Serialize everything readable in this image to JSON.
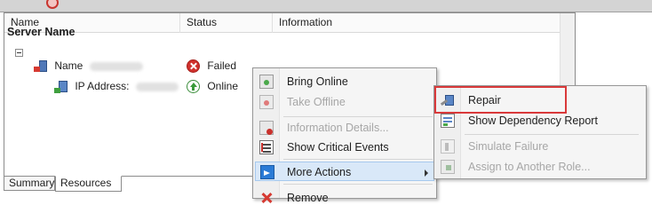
{
  "columns": {
    "name": "Name",
    "status": "Status",
    "information": "Information"
  },
  "group": {
    "label": "Server Name"
  },
  "rows": [
    {
      "name": "Name",
      "status": "Failed"
    },
    {
      "name": "IP Address:",
      "status": "Online"
    }
  ],
  "tabs": [
    {
      "label": "Summary",
      "active": false
    },
    {
      "label": "Resources",
      "active": true
    }
  ],
  "context_menu": {
    "items": [
      {
        "label": "Bring Online",
        "icon": "bring-online-icon",
        "enabled": true
      },
      {
        "label": "Take Offline",
        "icon": "take-offline-icon",
        "enabled": false
      },
      {
        "label": "Information Details...",
        "icon": "information-details-icon",
        "enabled": false
      },
      {
        "label": "Show Critical Events",
        "icon": "critical-events-icon",
        "enabled": true
      },
      {
        "label": "More Actions",
        "icon": "more-actions-icon",
        "enabled": true,
        "has_submenu": true,
        "highlighted": true
      },
      {
        "label": "Remove",
        "icon": "remove-icon",
        "enabled": true
      }
    ]
  },
  "submenu": {
    "items": [
      {
        "label": "Repair",
        "icon": "repair-icon",
        "enabled": true,
        "outlined": true
      },
      {
        "label": "Show Dependency Report",
        "icon": "dependency-report-icon",
        "enabled": true
      },
      {
        "label": "Simulate Failure",
        "icon": "simulate-failure-icon",
        "enabled": false
      },
      {
        "label": "Assign to Another Role...",
        "icon": "assign-role-icon",
        "enabled": false
      }
    ]
  },
  "colors": {
    "failed": "#d0312d",
    "online": "#3a9a3a",
    "highlight_outline": "#d9393a",
    "menu_hover": "#d9e8f8"
  }
}
